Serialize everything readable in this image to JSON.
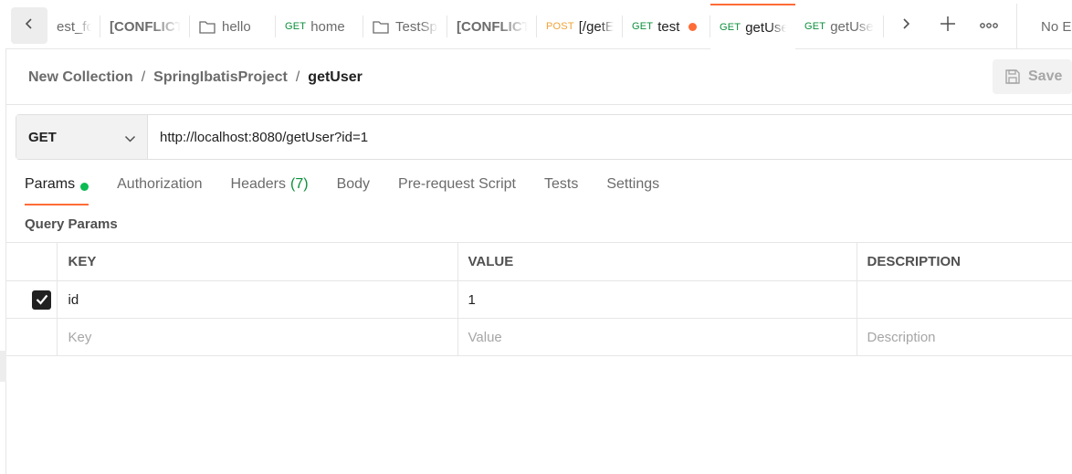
{
  "tabs": [
    {
      "method": "",
      "label": "est_for",
      "style": "plain"
    },
    {
      "method": "",
      "label": "[CONFLICT",
      "style": "bold"
    },
    {
      "method": "",
      "label": "hello",
      "style": "folder"
    },
    {
      "method": "GET",
      "label": "home",
      "style": "request"
    },
    {
      "method": "",
      "label": "TestSp",
      "style": "folder"
    },
    {
      "method": "",
      "label": "[CONFLICT",
      "style": "bold"
    },
    {
      "method": "POST",
      "label": "[/getE",
      "style": "request"
    },
    {
      "method": "GET",
      "label": "test",
      "style": "request-unsaved"
    },
    {
      "method": "GET",
      "label": "getUser",
      "style": "active"
    },
    {
      "method": "GET",
      "label": "getUse",
      "style": "request"
    }
  ],
  "environment": "No Environment",
  "breadcrumb": {
    "collection": "New Collection",
    "folder": "SpringIbatisProject",
    "current": "getUser",
    "separator": "/"
  },
  "save_label": "Save",
  "request": {
    "method": "GET",
    "url": "http://localhost:8080/getUser?id=1"
  },
  "request_tabs": {
    "params": "Params",
    "authorization": "Authorization",
    "headers": "Headers",
    "headers_count": "(7)",
    "body": "Body",
    "prerequest": "Pre-request Script",
    "tests": "Tests",
    "settings": "Settings"
  },
  "query_params": {
    "title": "Query Params",
    "columns": [
      "KEY",
      "VALUE",
      "DESCRIPTION"
    ],
    "rows": [
      {
        "checked": true,
        "key": "id",
        "value": "1",
        "description": ""
      }
    ],
    "placeholders": {
      "key": "Key",
      "value": "Value",
      "description": "Description"
    }
  },
  "colors": {
    "accent": "#ff6c37",
    "get": "#0c8f3c",
    "post": "#f0a236",
    "status_dot": "#0cbb52"
  },
  "icons": [
    "chevron-left-icon",
    "folder-icon",
    "chevron-right-icon",
    "plus-icon",
    "more-icon",
    "chevron-down-icon",
    "save-icon",
    "checkbox-checked-icon"
  ]
}
